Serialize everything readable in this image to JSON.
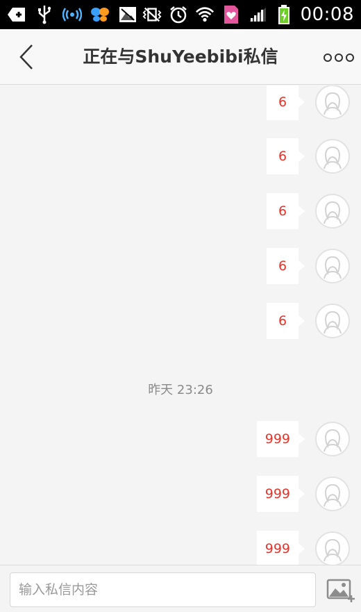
{
  "status_bar": {
    "time": "00:08",
    "left_icons": [
      "add-notification-icon",
      "usb-icon",
      "hotspot-icon",
      "butterfly-app-icon",
      "photo-icon"
    ],
    "right_icons": [
      "vibrate-icon",
      "alarm-icon",
      "wifi-icon",
      "heart-sim-icon",
      "signal-icon",
      "battery-charging-icon"
    ]
  },
  "nav": {
    "title": "正在与ShuYeebibi私信"
  },
  "messages": [
    {
      "text": "6"
    },
    {
      "text": "6"
    },
    {
      "text": "6"
    },
    {
      "text": "6"
    },
    {
      "text": "6"
    }
  ],
  "timestamp": "昨天 23:26",
  "messages_after": [
    {
      "text": "999"
    },
    {
      "text": "999"
    },
    {
      "text": "999"
    }
  ],
  "input": {
    "placeholder": "输入私信内容",
    "value": ""
  },
  "colors": {
    "accent": "#e8332a",
    "background": "#f4f4f4",
    "statusbar": "#000000"
  }
}
